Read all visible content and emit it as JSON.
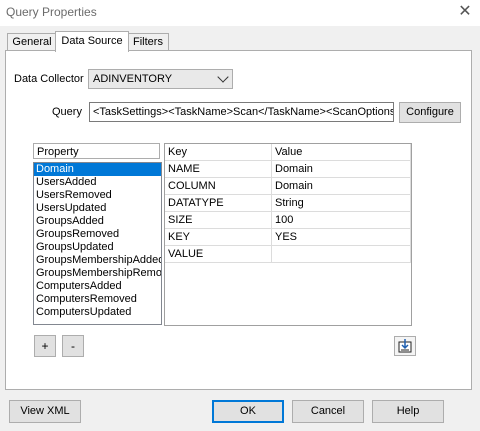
{
  "window": {
    "title": "Query Properties"
  },
  "tabs": [
    {
      "label": "General"
    },
    {
      "label": "Data Source"
    },
    {
      "label": "Filters"
    }
  ],
  "data_collector": {
    "label": "Data Collector",
    "value": "ADINVENTORY"
  },
  "query": {
    "label": "Query",
    "value": "<TaskSettings><TaskName>Scan</TaskName><ScanOptions",
    "configure_label": "Configure"
  },
  "property_list": {
    "header": "Property",
    "items": [
      "Domain",
      "UsersAdded",
      "UsersRemoved",
      "UsersUpdated",
      "GroupsAdded",
      "GroupsRemoved",
      "GroupsUpdated",
      "GroupsMembershipAdded",
      "GroupsMembershipRemov",
      "ComputersAdded",
      "ComputersRemoved",
      "ComputersUpdated"
    ],
    "add_label": "+",
    "remove_label": "-"
  },
  "grid": {
    "headers": [
      "Key",
      "Value"
    ],
    "rows": [
      [
        "NAME",
        "Domain"
      ],
      [
        "COLUMN",
        "Domain"
      ],
      [
        "DATATYPE",
        "String"
      ],
      [
        "SIZE",
        "100"
      ],
      [
        "KEY",
        "YES"
      ],
      [
        "VALUE",
        ""
      ]
    ]
  },
  "footer": {
    "view_xml_label": "View XML",
    "ok_label": "OK",
    "cancel_label": "Cancel",
    "help_label": "Help"
  },
  "icons": {
    "close": "close-icon",
    "dropdown": "chevron-down-icon",
    "import": "import-icon"
  },
  "colors": {
    "selection": "#0078d7",
    "default_button_border": "#0078d7"
  }
}
